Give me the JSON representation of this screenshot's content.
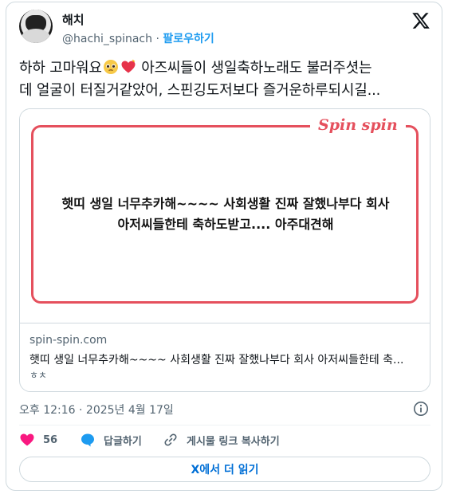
{
  "author": {
    "name": "해치",
    "handle": "@hachi_spinach",
    "separator": "·",
    "follow_label": "팔로우하기"
  },
  "tweet": {
    "text_part1": "하하 고마워요",
    "text_part2": " 아즈씨들이 생일축하노래도 불러주셧는",
    "text_line2": "데 얼굴이 터질거같았어, 스핀깅도저보다 즐거운하루되시길..."
  },
  "link_card": {
    "brand": "Spin spin",
    "preview_line1": "햇띠 생일 너무추카해~~~~ 사회생활 진짜 잘했나부다 회사",
    "preview_line2": "아저씨들한테 축하도받고.... 아주대견해",
    "domain": "spin-spin.com",
    "title": "햇띠 생일 너무추카해~~~~ 사회생활 진짜 잘했나부다 회사 아저씨들한테 축...",
    "description": "ㅎㅊ"
  },
  "meta": {
    "timestamp": "오후 12:16 · 2025년 4월 17일"
  },
  "actions": {
    "like_count": "56",
    "reply_label": "답글하기",
    "copy_link_label": "게시물 링크 복사하기"
  },
  "read_more_label": "X에서 더 읽기",
  "icons": {
    "x_logo": "x-logo-icon",
    "info": "info-icon",
    "like": "heart-icon",
    "reply": "reply-bubble-icon",
    "link": "link-icon",
    "emoji1": "pleading-face-emoji",
    "emoji2": "heart-emoji"
  },
  "colors": {
    "link_blue": "#1d9bf0",
    "like_pink": "#f91880",
    "brand_red": "#e5505d",
    "muted": "#536471"
  }
}
